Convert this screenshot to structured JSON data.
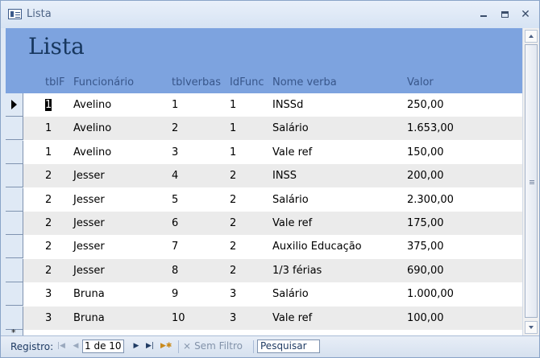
{
  "window": {
    "title": "Lista"
  },
  "form": {
    "title": "Lista"
  },
  "columns": {
    "tblf": "tblF",
    "funcionario": "Funcionário",
    "tblverbas": "tblverbas",
    "idfunc": "IdFunc",
    "nome_verba": "Nome verba",
    "valor": "Valor"
  },
  "rows": [
    {
      "tblf": "1",
      "funcionario": "Avelino",
      "tblverbas": "1",
      "idfunc": "1",
      "nome_verba": "INSSd",
      "valor": "250,00"
    },
    {
      "tblf": "1",
      "funcionario": "Avelino",
      "tblverbas": "2",
      "idfunc": "1",
      "nome_verba": "Salário",
      "valor": "1.653,00"
    },
    {
      "tblf": "1",
      "funcionario": "Avelino",
      "tblverbas": "3",
      "idfunc": "1",
      "nome_verba": "Vale ref",
      "valor": "150,00"
    },
    {
      "tblf": "2",
      "funcionario": "Jesser",
      "tblverbas": "4",
      "idfunc": "2",
      "nome_verba": "INSS",
      "valor": "200,00"
    },
    {
      "tblf": "2",
      "funcionario": "Jesser",
      "tblverbas": "5",
      "idfunc": "2",
      "nome_verba": "Salário",
      "valor": "2.300,00"
    },
    {
      "tblf": "2",
      "funcionario": "Jesser",
      "tblverbas": "6",
      "idfunc": "2",
      "nome_verba": "Vale ref",
      "valor": "175,00"
    },
    {
      "tblf": "2",
      "funcionario": "Jesser",
      "tblverbas": "7",
      "idfunc": "2",
      "nome_verba": "Auxilio Educação",
      "valor": "375,00"
    },
    {
      "tblf": "2",
      "funcionario": "Jesser",
      "tblverbas": "8",
      "idfunc": "2",
      "nome_verba": "1/3 férias",
      "valor": "690,00"
    },
    {
      "tblf": "3",
      "funcionario": "Bruna",
      "tblverbas": "9",
      "idfunc": "3",
      "nome_verba": "Salário",
      "valor": "1.000,00"
    },
    {
      "tblf": "3",
      "funcionario": "Bruna",
      "tblverbas": "10",
      "idfunc": "3",
      "nome_verba": "Vale ref",
      "valor": "100,00"
    }
  ],
  "navigation": {
    "label": "Registro:",
    "record": "1 de 10",
    "filter_label": "Sem Filtro",
    "search_placeholder": "Pesquisar"
  },
  "colors": {
    "header_band": "#7da3df",
    "title_text": "#17375e",
    "column_label": "#38568a",
    "alt_row": "#ebebeb"
  }
}
